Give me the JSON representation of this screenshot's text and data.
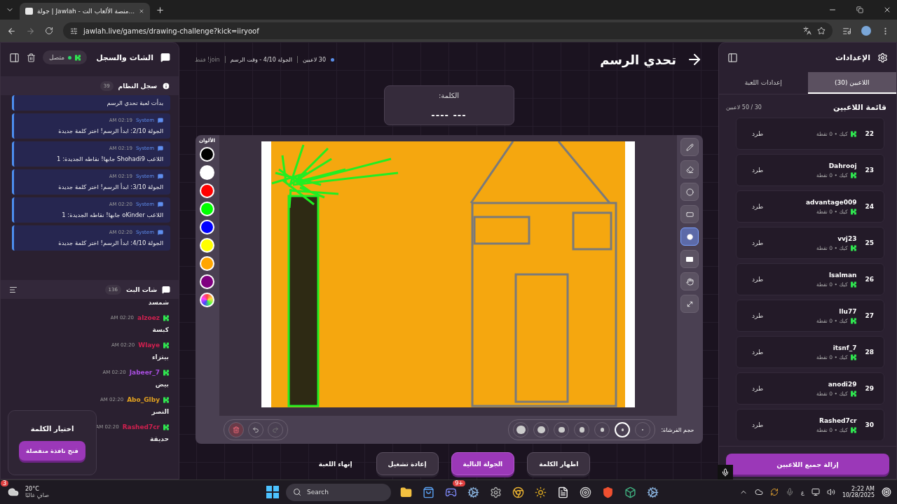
{
  "browser": {
    "tab_title": "جولة | Jawlah - منصة الألعاب الت...",
    "url": "jawlah.live/games/drawing-challenge?kick=iiryoof"
  },
  "chat_panel": {
    "title": "الشات والسجل",
    "status": "متصل",
    "system_log": {
      "title": "سجل النظام",
      "count": "39",
      "messages": [
        {
          "text": "بدأت لعبة تحدي الرسم"
        },
        {
          "sender": "System",
          "time": "02:19 AM",
          "text": "الجولة 2/10: ابدأ الرسم! اختر كلمة جديدة"
        },
        {
          "sender": "System",
          "time": "02:19 AM",
          "text": "اللاعب Shohadi9 جابها! نقاطه الجديدة: 1"
        },
        {
          "sender": "System",
          "time": "02:19 AM",
          "text": "الجولة 3/10: ابدأ الرسم! اختر كلمة جديدة"
        },
        {
          "sender": "System",
          "time": "02:20 AM",
          "text": "اللاعب oKinder جابها! نقاطه الجديدة: 1"
        },
        {
          "sender": "System",
          "time": "02:20 AM",
          "text": "الجولة 4/10: ابدأ الرسم! اختر كلمة جديدة"
        }
      ]
    },
    "stream_chat": {
      "title": "شات البث",
      "count": "136",
      "messages": [
        {
          "text": "شمسد"
        },
        {
          "user": "alzoez",
          "color": "#d0204f",
          "time": "02:20 AM",
          "text": "كبسة"
        },
        {
          "user": "Wlaye",
          "color": "#d0204f",
          "time": "02:20 AM",
          "text": "بيتزاء"
        },
        {
          "user": "Jabeer_7",
          "color": "#a84ee0",
          "time": "02:20 AM",
          "text": "بيض"
        },
        {
          "user": "Abo_Glby",
          "color": "#e0a020",
          "time": "02:20 AM",
          "text": "النصر"
        },
        {
          "user": "Rashed7cr",
          "color": "#d0204f",
          "time": "02:20 AM",
          "text": "حديقة"
        }
      ]
    },
    "word_choice": {
      "title": "اختيار الكلمة",
      "button": "فتح نافذة منفصلة"
    }
  },
  "game": {
    "title": "تحدي الرسم",
    "players": "30 لاعبين",
    "round": "الجولة 4/10 - وقت الرسم",
    "mode": "join! فقط",
    "word_label": "الكلمة:",
    "word_hint": "--- ----",
    "colors_label": "الألوان",
    "colors": [
      {
        "color": "#000000",
        "selected": false
      },
      {
        "color": "#ffffff",
        "selected": false
      },
      {
        "color": "#ff0000",
        "selected": false
      },
      {
        "color": "#00ff00",
        "selected": false
      },
      {
        "color": "#0000ff",
        "selected": false
      },
      {
        "color": "#ffff00",
        "selected": false
      },
      {
        "color": "#ffa500",
        "selected": false
      },
      {
        "color": "#800080",
        "selected": false
      }
    ],
    "tools": [
      {
        "kind": "pencil",
        "selected": false
      },
      {
        "kind": "eraser",
        "selected": false
      },
      {
        "kind": "circle",
        "selected": false
      },
      {
        "kind": "rectangle",
        "selected": false
      },
      {
        "kind": "filled-circle",
        "selected": true
      },
      {
        "kind": "filled-rectangle",
        "selected": false
      },
      {
        "kind": "hand",
        "selected": false
      },
      {
        "kind": "line",
        "selected": false
      }
    ],
    "brush_label": "حجم الفرشاة:",
    "brush_sizes": [
      {
        "selected": false
      },
      {
        "selected": true
      },
      {
        "selected": false
      },
      {
        "selected": false
      },
      {
        "selected": false
      },
      {
        "selected": false
      },
      {
        "selected": false
      }
    ],
    "actions": [
      {
        "label": "اظهار الكلمة",
        "kind": "secondary"
      },
      {
        "label": "الجولة التالية",
        "kind": "primary"
      },
      {
        "label": "إعادة تشغيل",
        "kind": "secondary"
      },
      {
        "label": "إنهاء اللعبة",
        "kind": "plain"
      }
    ]
  },
  "settings_panel": {
    "title": "الإعدادات",
    "tabs": [
      {
        "label": "اللاعبين (30)",
        "selected": true
      },
      {
        "label": "إعدادات اللعبة",
        "selected": false
      }
    ],
    "list_title": "قائمة اللاعبين",
    "capacity": "30 / 50 لاعبين",
    "players": [
      {
        "number": "22",
        "meta": "كيك • 0 نقطة",
        "action": "طرد"
      },
      {
        "number": "23",
        "name": "Dahrooj",
        "meta": "كيك • 0 نقطة",
        "action": "طرد"
      },
      {
        "number": "24",
        "name": "advantage009",
        "meta": "كيك • 0 نقطة",
        "action": "طرد"
      },
      {
        "number": "25",
        "name": "vvj23",
        "meta": "كيك • 0 نقطة",
        "action": "طرد"
      },
      {
        "number": "26",
        "name": "lsalman",
        "meta": "كيك • 0 نقطة",
        "action": "طرد"
      },
      {
        "number": "27",
        "name": "llu77",
        "meta": "كيك • 0 نقطة",
        "action": "طرد"
      },
      {
        "number": "28",
        "name": "itsnf_7",
        "meta": "كيك • 0 نقطة",
        "action": "طرد"
      },
      {
        "number": "29",
        "name": "anodi29",
        "meta": "كيك • 0 نقطة",
        "action": "طرد"
      },
      {
        "number": "30",
        "name": "Rashed7cr",
        "meta": "كيك • 0 نقطة",
        "action": "طرد"
      }
    ],
    "remove_all": "إزالة جميع اللاعبين"
  },
  "taskbar": {
    "temperature": "20°C",
    "weather": "صافٍ غالبًا",
    "weather_badge": "3",
    "search": "Search",
    "discord_badge": "9+",
    "language": "ع",
    "time": "2:22 AM",
    "date": "10/28/2025"
  }
}
